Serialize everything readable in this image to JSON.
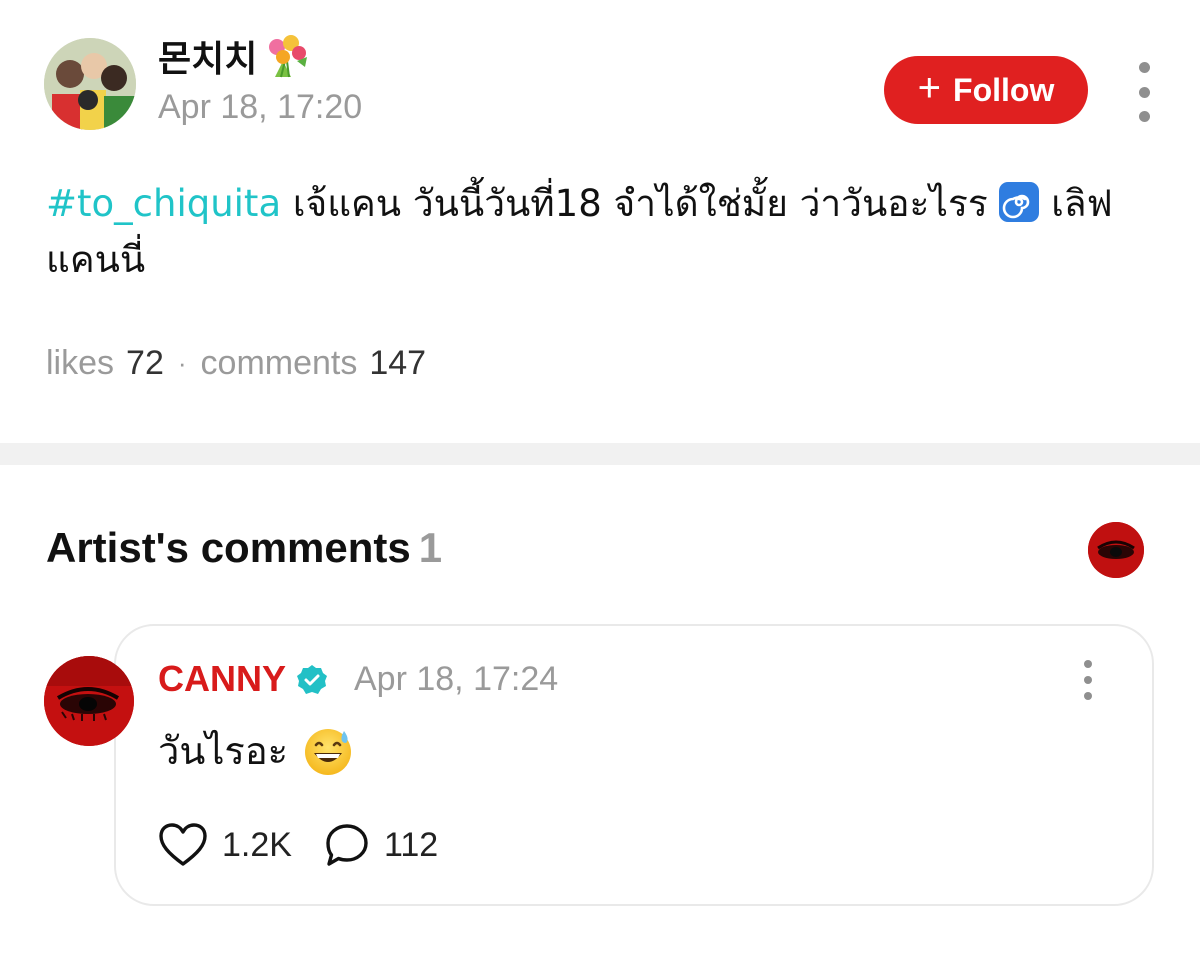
{
  "post": {
    "author": {
      "name": "몬치치",
      "name_emoji_icon": "bouquet-icon",
      "timestamp": "Apr 18, 17:20"
    },
    "follow_button": {
      "icon": "plus-icon",
      "label": "Follow"
    },
    "more_icon": "more-vertical-icon",
    "hashtag": "#to_chiquita",
    "text_part1": " เจ้แคน วันนี้วันที่18 จำได้ใช่มั้ย ว่าวันอะไรร ",
    "emoji_icon": "spiral-icon",
    "text_part2": " เลิฟแคนนี่",
    "stats": {
      "likes_label": "likes",
      "likes_value": "72",
      "separator": "·",
      "comments_label": "comments",
      "comments_value": "147"
    }
  },
  "artist_comments": {
    "title": "Artist's comments",
    "count": "1",
    "comment": {
      "author": "CANNY",
      "verified_icon": "verified-badge-icon",
      "timestamp": "Apr 18, 17:24",
      "more_icon": "more-vertical-icon",
      "text": "วันไรอะ",
      "emoji_icon": "grinning-sweat-emoji",
      "likes": "1.2K",
      "replies": "112"
    }
  },
  "colors": {
    "accent_red": "#e02020",
    "hashtag_teal": "#20c4c8",
    "artist_name_red": "#d81b1b",
    "muted_gray": "#9a9a9a"
  }
}
